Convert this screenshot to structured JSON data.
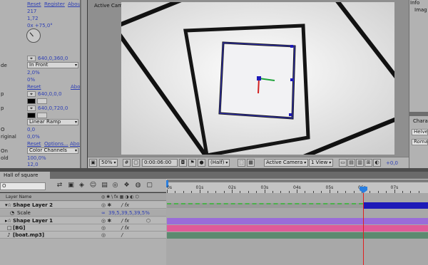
{
  "effect_controls": {
    "rows": [
      {
        "label": "",
        "value": "Reset",
        "link2": "Register",
        "link3": "About"
      },
      {
        "label": "",
        "value": "217"
      },
      {
        "label": "",
        "value": "1,72"
      },
      {
        "label": "",
        "value": "0x +75,0°"
      },
      {
        "label": "",
        "value": "640,0,360,0"
      },
      {
        "label": "de",
        "value": "In Front"
      },
      {
        "label": "riginal",
        "value": "2,0%"
      },
      {
        "label": "",
        "value": "0%"
      },
      {
        "label": "",
        "value": "Reset",
        "link2": "About"
      },
      {
        "label": "p",
        "value": "640,0,0,0"
      },
      {
        "label": "p",
        "value": "640,0,720,0"
      },
      {
        "label": "",
        "value": "Linear Ramp"
      },
      {
        "label": "O",
        "value": "0,0"
      },
      {
        "label": "riginal",
        "value": "0,0%"
      },
      {
        "label": "",
        "value": "Reset",
        "link2": "Options...",
        "link3": "About"
      },
      {
        "label": "On",
        "value": "Color Channels"
      },
      {
        "label": "old",
        "value": "100,0%"
      },
      {
        "label": "",
        "value": "12,0"
      },
      {
        "label": "ty",
        "value": "2,4"
      }
    ]
  },
  "viewer": {
    "label": "Active Camera",
    "zoom": "50%",
    "timecode": "0:00:06:00",
    "resolution": "(Half)",
    "camera": "Active Camera",
    "views": "1 View",
    "exposure": "+0,0"
  },
  "right_panel": {
    "tab1": "Info",
    "tab2": "Imag",
    "char_title": "Chara",
    "font_family": "Helvet",
    "font_style": "Roman"
  },
  "timeline": {
    "tab": "Hall of square",
    "search_placeholder": "O",
    "col_layer_name": "Layer Name",
    "col_switches": "",
    "ruler": [
      "0s",
      "01s",
      "02s",
      "03s",
      "04s",
      "05s",
      "06s",
      "07s"
    ],
    "layers": [
      {
        "name": "Shape Layer 2",
        "type": "star"
      },
      {
        "name": "Scale",
        "value": "39,5,39,5,39,5%"
      },
      {
        "name": "Shape Layer 1",
        "type": "star"
      },
      {
        "name": "[BG]",
        "type": "solid"
      },
      {
        "name": "[boat.mp3]",
        "type": "audio"
      }
    ],
    "colors": {
      "shape2": "#1e1ab8",
      "shape1": "#9a6cd8",
      "bg": "#e05a98",
      "audio": "#5c8a70"
    }
  }
}
